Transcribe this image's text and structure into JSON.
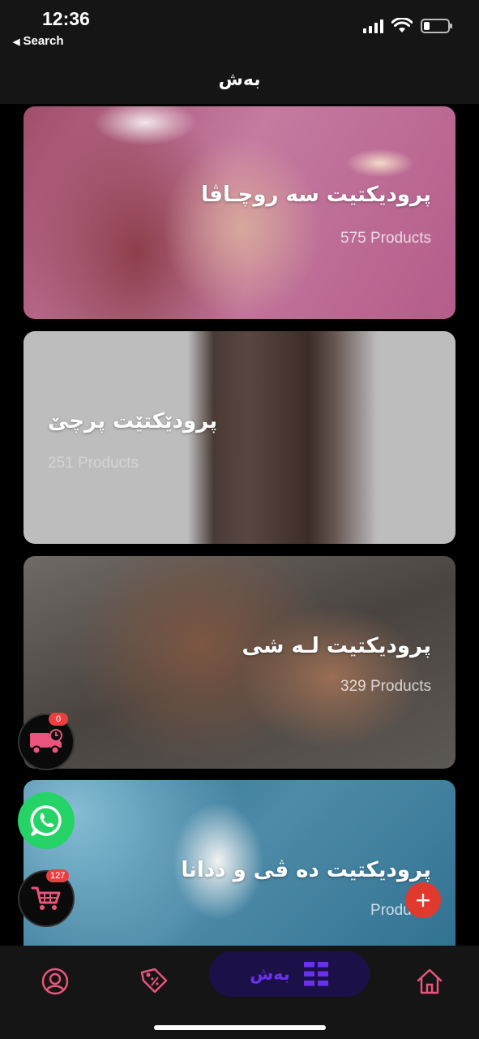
{
  "status_bar": {
    "time": "12:36",
    "back_label": "Search"
  },
  "header": {
    "title": "بەش"
  },
  "categories": [
    {
      "title": "پرودیکتیت سه روچـاڤا",
      "count": "575 Products"
    },
    {
      "title": "پرودێکتێت پرچێ",
      "count": "251 Products"
    },
    {
      "title": "پرودیکتیت لـه شی",
      "count": "329 Products"
    },
    {
      "title": "پرودیکتیت ده ڤی و ددانا",
      "count": "Products"
    }
  ],
  "floating": {
    "delivery_badge": "0",
    "cart_badge": "127",
    "add_label": "+"
  },
  "bottom_nav": {
    "active_label": "بەش"
  },
  "colors": {
    "accent_pink": "#e8547c",
    "accent_purple": "#6b30f0",
    "whatsapp_green": "#25d366",
    "add_red": "#e03a2f"
  }
}
